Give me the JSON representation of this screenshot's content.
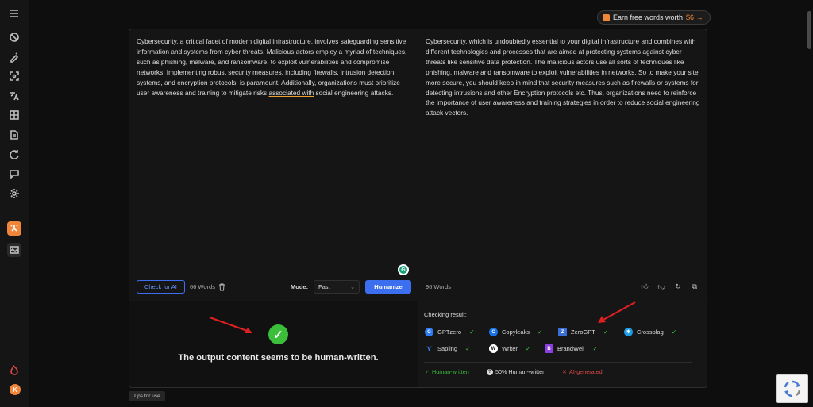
{
  "sidebar": {
    "icons": [
      "menu-icon",
      "no-eye-icon",
      "edit-magic-icon",
      "scan-icon",
      "translate-icon",
      "grid-icon",
      "document-icon",
      "refresh-icon",
      "chat-icon",
      "settings-icon",
      "humanizer-icon",
      "image-icon",
      "flame-icon"
    ],
    "avatar_letter": "K"
  },
  "promo": {
    "label": "Earn free words worth",
    "amount": "$6",
    "arrow": "→"
  },
  "input": {
    "text_before": "Cybersecurity, a critical facet of modern digital infrastructure, involves safeguarding sensitive information and systems from cyber threats. Malicious actors employ a myriad of techniques, such as phishing, malware, and ransomware, to exploit vulnerabilities and compromise networks. Implementing robust security measures, including firewalls, intrusion detection systems, and encryption protocols, is paramount. Additionally, organizations must prioritize user awareness and training to mitigate risks ",
    "text_underlined": "associated with",
    "text_after": " social engineering attacks.",
    "check_ai_label": "Check for AI",
    "word_count": "66 Words",
    "mode_label": "Mode:",
    "mode_value": "Fast",
    "humanize_label": "Humanize"
  },
  "output": {
    "text": "Cybersecurity, which is undoubtedly essential to your digital infrastructure and combines with different technologies and processes that are aimed at protecting systems against cyber threats like sensitive data protection. The malicious actors use all sorts of techniques like phishing, malware and ransomware to exploit vulnerabilities in networks. So to make your site more secure, you should keep in mind that security measures such as firewalls or systems for detecting intrusions and other Encryption protocols etc. Thus, organizations need to reinforce the importance of user awareness and training strategies in order to reduce social engineering attack vectors.",
    "word_count": "96 Words"
  },
  "result": {
    "message": "The output content seems to be human-written.",
    "checking_title": "Checking result:",
    "detectors": [
      {
        "name": "GPTzero",
        "color": "#2f7df6"
      },
      {
        "name": "Copyleaks",
        "color": "#1a73e8"
      },
      {
        "name": "ZeroGPT",
        "color": "#3a6fd8"
      },
      {
        "name": "Crossplag",
        "color": "#1e9be6"
      },
      {
        "name": "Sapling",
        "color": "#3b82f6"
      },
      {
        "name": "Writer",
        "color": "#ffffff"
      },
      {
        "name": "BrandWell",
        "color": "#8b3fe0"
      }
    ],
    "legend": {
      "human": "Human-written",
      "half": "50% Human-written",
      "ai": "AI-generated"
    }
  },
  "tips_label": "Tips for use",
  "colors": {
    "accent": "#f0863a",
    "primary": "#3b6ff0",
    "success": "#3bbf3b",
    "danger": "#e04848"
  }
}
